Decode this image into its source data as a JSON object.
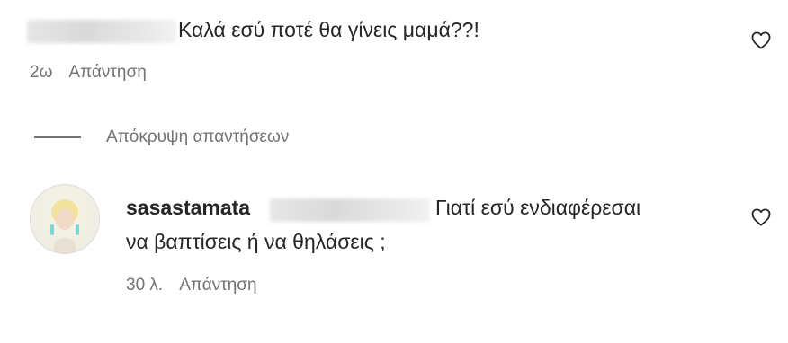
{
  "comment1": {
    "text": "Καλά εσύ ποτέ θα γίνεις μαμά??!",
    "time": "2ω",
    "reply_label": "Απάντηση"
  },
  "replies_toggle": {
    "label": "Απόκρυψη απαντήσεων"
  },
  "comment2": {
    "username": "sasastamata",
    "text_line1": "Γιατί εσύ ενδιαφέρεσαι",
    "text_line2": "να βαπτίσεις ή να θηλάσεις ;",
    "time": "30 λ.",
    "reply_label": "Απάντηση"
  },
  "icons": {
    "like": "heart-outline-icon",
    "avatar": "profile-avatar"
  },
  "colors": {
    "text": "#262626",
    "secondary": "#737373",
    "border": "#dbdbdb"
  }
}
